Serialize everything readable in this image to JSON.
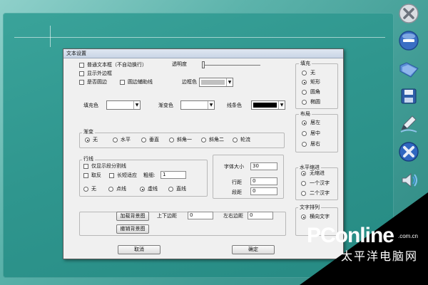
{
  "dialog": {
    "title": "文本设置",
    "options": {
      "plain_textbox": "普通文本框（不自动换行）",
      "show_border": "显示外边框",
      "round_border": "是否圆边",
      "round_aux": "圆边辅助线",
      "border_color_label": "边框色"
    },
    "opacity_label": "透明度",
    "colors": {
      "fill_label": "填充色",
      "gradient_label": "渐变色",
      "line_label": "线条色",
      "fill_value": "#ffffff",
      "gradient_value": "#ffffff",
      "line_value": "#000000",
      "border_value": "#c0c0c0"
    },
    "fill": {
      "legend": "填充",
      "options": [
        "无",
        "矩形",
        "圆角",
        "椭圆"
      ],
      "selected": "矩形"
    },
    "gradient": {
      "legend": "渐变",
      "options": [
        "无",
        "水平",
        "垂直",
        "斜角一",
        "斜角二",
        "轮流"
      ],
      "selected": "无"
    },
    "layout": {
      "legend": "布局",
      "options": [
        "居左",
        "居中",
        "居右"
      ],
      "selected": "居左"
    },
    "lines": {
      "legend": "行线",
      "only_paragraph": "仅显示段分割线",
      "reverse": "取反",
      "long_adapt": "长短适应",
      "thickness_label": "粗细:",
      "thickness_value": "1",
      "style_options": [
        "无",
        "点线",
        "虚线",
        "直线"
      ],
      "style_selected": "虚线"
    },
    "font": {
      "size_label": "字体大小",
      "size_value": "30",
      "line_spacing_label": "行距",
      "line_spacing_value": "0",
      "para_spacing_label": "段距",
      "para_spacing_value": "0"
    },
    "indent": {
      "legend": "水平缩进",
      "options": [
        "无缩进",
        "一个汉字",
        "二个汉字"
      ],
      "selected": "无缩进"
    },
    "text_direction": {
      "legend": "文字排列",
      "options": [
        "横向文字"
      ],
      "selected": "横向文字"
    },
    "background": {
      "load_button": "加载背景图",
      "clear_button": "撤销背景图",
      "top_bottom_label": "上下边距",
      "top_bottom_value": "0",
      "left_right_label": "左右边距",
      "left_right_value": "0"
    },
    "buttons": {
      "cancel": "取消",
      "ok": "确定"
    }
  },
  "toolbar": {
    "icons": [
      "close-icon",
      "minus-icon",
      "folder-icon",
      "save-icon",
      "pen-icon",
      "tools-icon",
      "speaker-icon"
    ]
  },
  "watermark": {
    "logo": "PConline",
    "domain": ".com.cn",
    "chinese": "太平洋电脑网"
  }
}
